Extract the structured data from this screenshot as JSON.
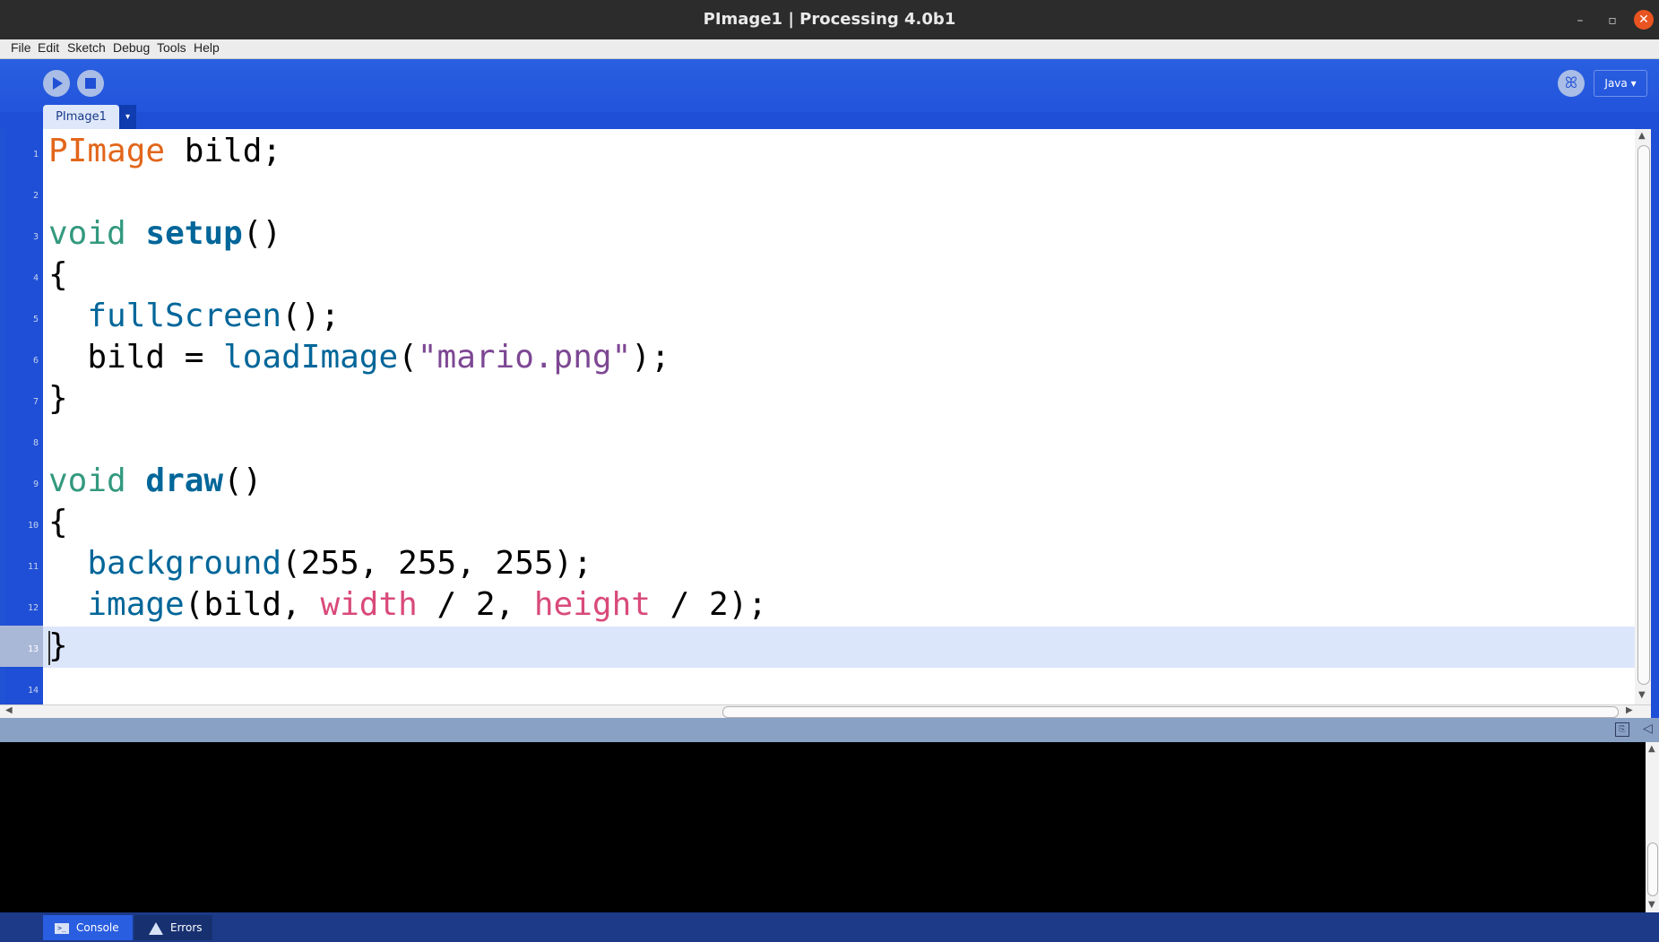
{
  "window": {
    "title": "PImage1 | Processing 4.0b1"
  },
  "window_controls": {
    "minimize": "–",
    "maximize": "▫",
    "close": "✕"
  },
  "menu": [
    "File",
    "Edit",
    "Sketch",
    "Debug",
    "Tools",
    "Help"
  ],
  "toolbar": {
    "mode": "Java ▾",
    "debug_glyph": "ꕤ"
  },
  "tabs": [
    {
      "label": "PImage1"
    }
  ],
  "tab_menu_glyph": "▾",
  "editor": {
    "line_numbers": [
      "1",
      "2",
      "3",
      "4",
      "5",
      "6",
      "7",
      "8",
      "9",
      "10",
      "11",
      "12",
      "13",
      "14"
    ],
    "current_line": 13,
    "lines": [
      [
        {
          "t": "PImage",
          "c": "kw-type"
        },
        {
          "t": " bild;",
          "c": ""
        }
      ],
      [],
      [
        {
          "t": "void",
          "c": "kw-void"
        },
        {
          "t": " ",
          "c": ""
        },
        {
          "t": "setup",
          "c": "kw-fn"
        },
        {
          "t": "()",
          "c": ""
        }
      ],
      [
        {
          "t": "{",
          "c": ""
        }
      ],
      [
        {
          "t": "  ",
          "c": ""
        },
        {
          "t": "fullScreen",
          "c": "kw-call"
        },
        {
          "t": "();",
          "c": ""
        }
      ],
      [
        {
          "t": "  bild = ",
          "c": ""
        },
        {
          "t": "loadImage",
          "c": "kw-call"
        },
        {
          "t": "(",
          "c": ""
        },
        {
          "t": "\"mario.png\"",
          "c": "kw-str"
        },
        {
          "t": ");",
          "c": ""
        }
      ],
      [
        {
          "t": "}",
          "c": ""
        }
      ],
      [],
      [
        {
          "t": "void",
          "c": "kw-void"
        },
        {
          "t": " ",
          "c": ""
        },
        {
          "t": "draw",
          "c": "kw-fn"
        },
        {
          "t": "()",
          "c": ""
        }
      ],
      [
        {
          "t": "{",
          "c": ""
        }
      ],
      [
        {
          "t": "  ",
          "c": ""
        },
        {
          "t": "background",
          "c": "kw-call"
        },
        {
          "t": "(255, 255, 255);",
          "c": ""
        }
      ],
      [
        {
          "t": "  ",
          "c": ""
        },
        {
          "t": "image",
          "c": "kw-call"
        },
        {
          "t": "(bild, ",
          "c": ""
        },
        {
          "t": "width",
          "c": "kw-const"
        },
        {
          "t": " / 2, ",
          "c": ""
        },
        {
          "t": "height",
          "c": "kw-const"
        },
        {
          "t": " / 2);",
          "c": ""
        }
      ],
      [
        {
          "t": "}",
          "c": ""
        }
      ],
      []
    ]
  },
  "footer": {
    "console_label": "Console",
    "errors_label": "Errors"
  },
  "colors": {
    "toolbar_blue": "#1f4fd6",
    "type_orange": "#e2661a",
    "void_green": "#33997e",
    "function_blue": "#006699",
    "string_purple": "#7d4793",
    "constant_pink": "#d94a7a"
  }
}
